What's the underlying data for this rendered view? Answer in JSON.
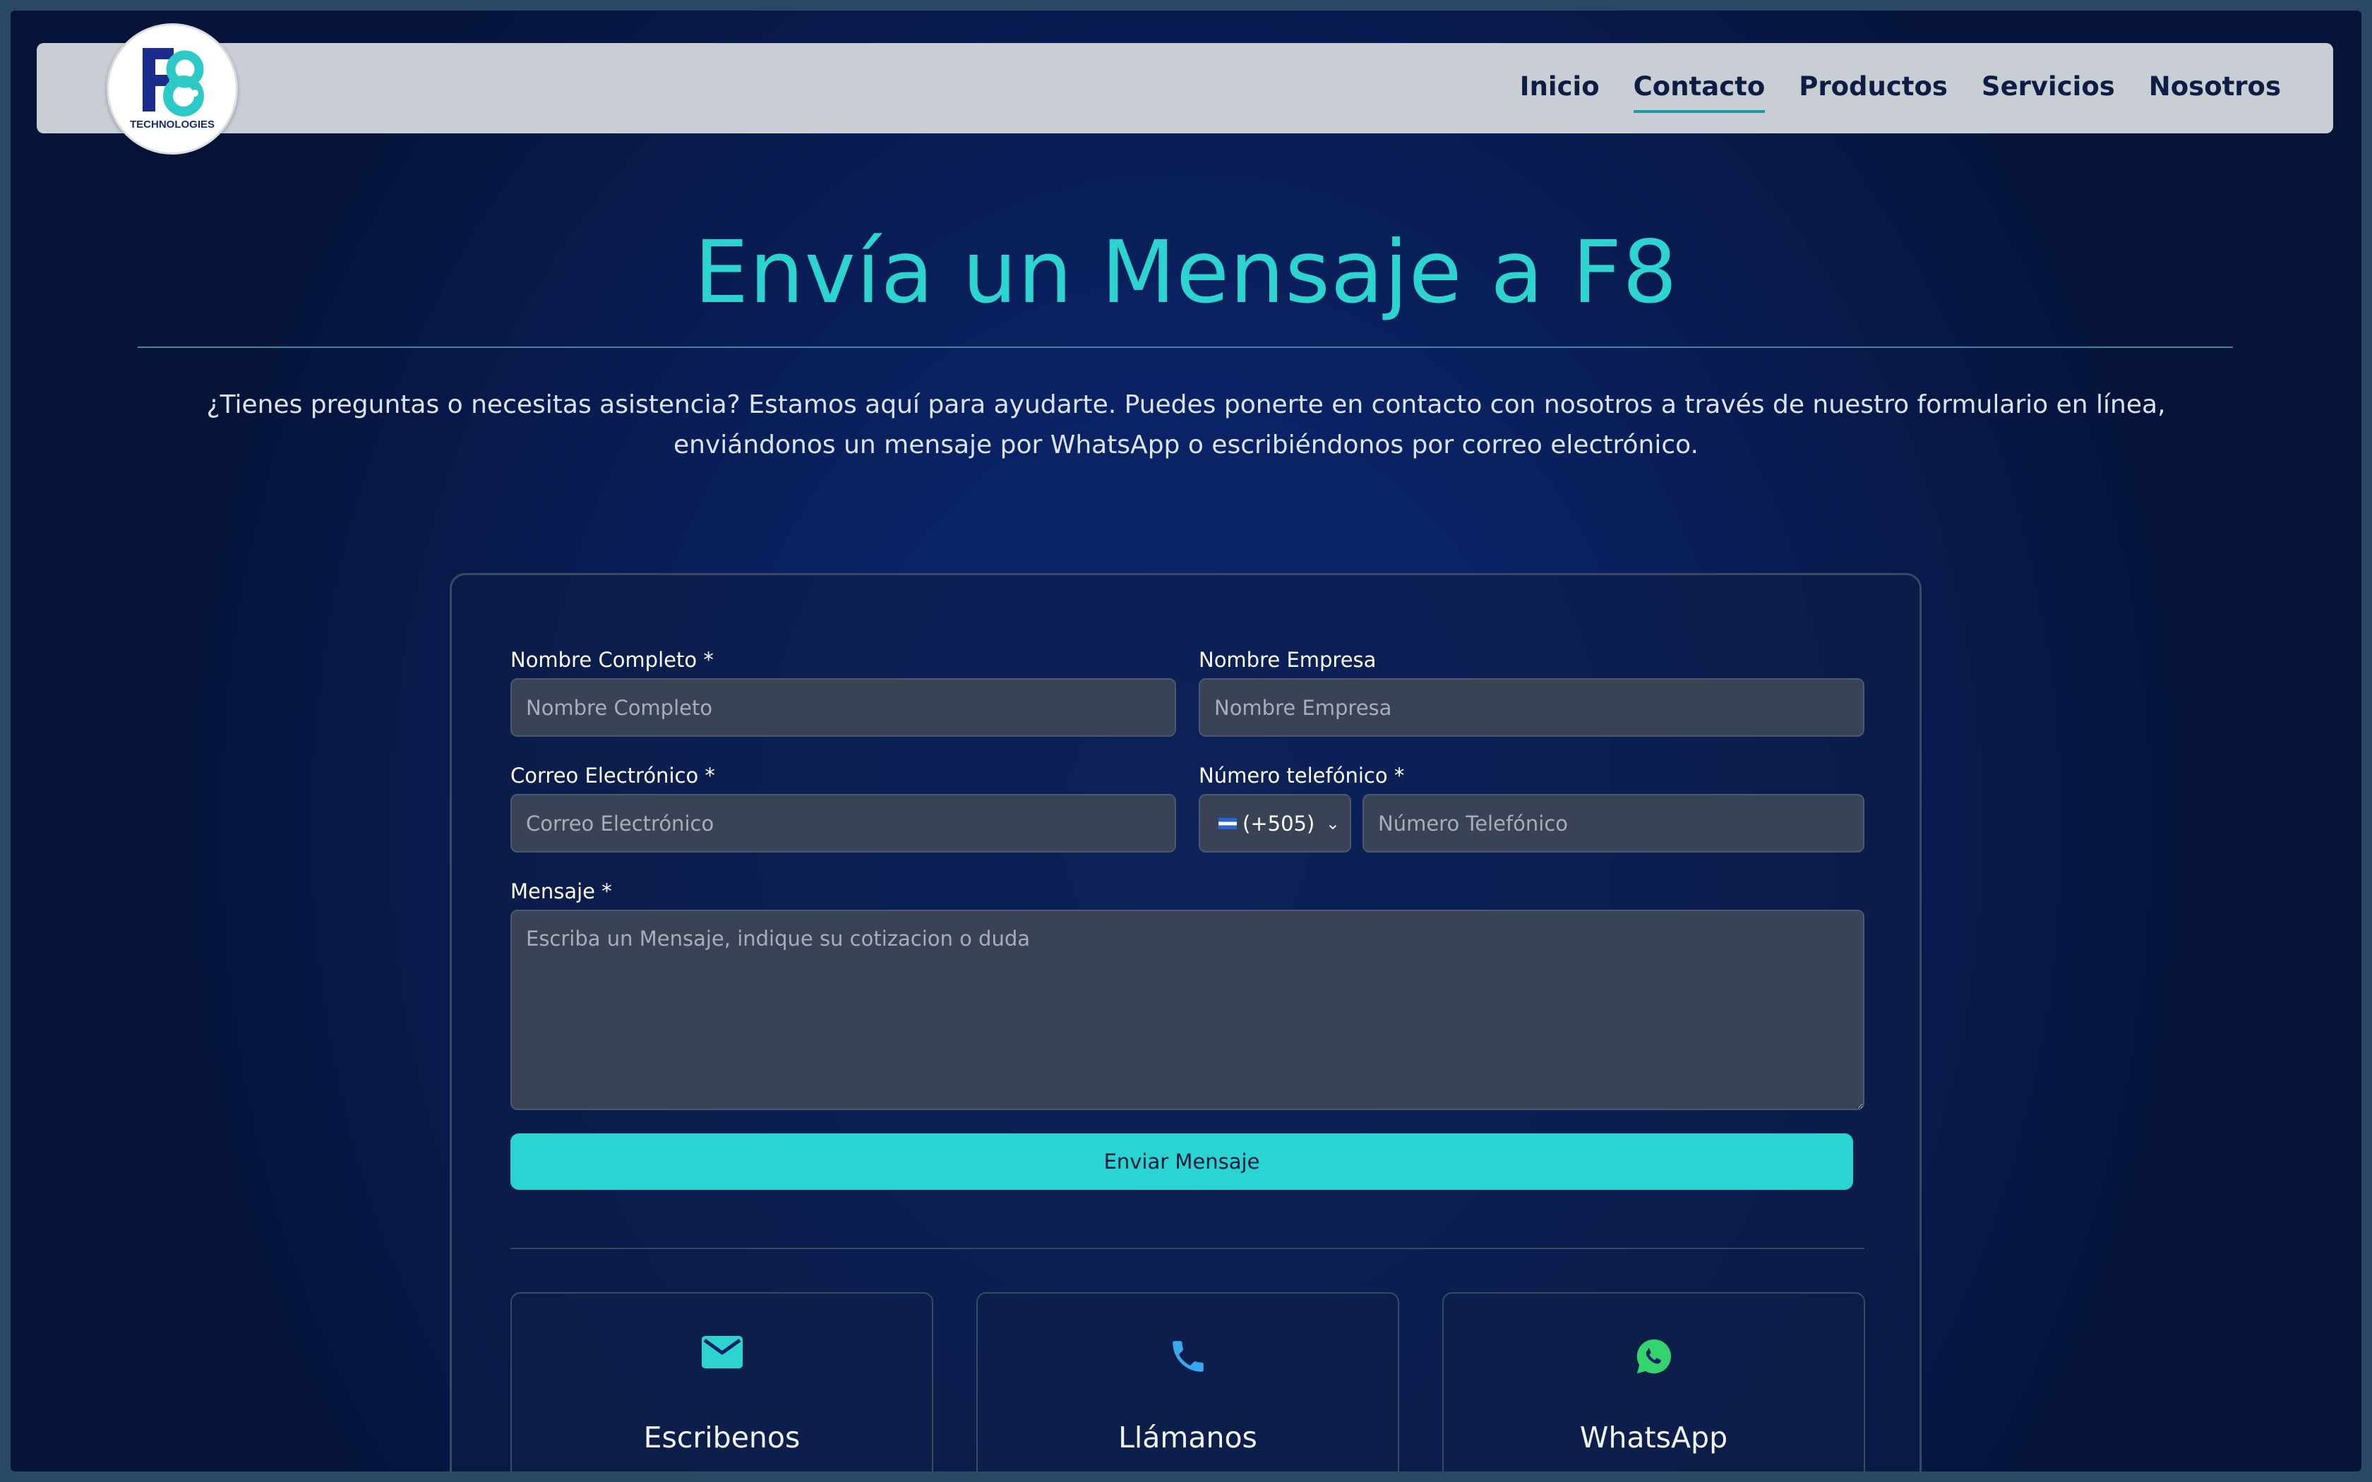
{
  "brand": {
    "logo_alt": "F8 Technologies",
    "logo_text": "TECHNOLOGIES"
  },
  "nav": {
    "items": [
      {
        "label": "Inicio"
      },
      {
        "label": "Contacto",
        "active": true
      },
      {
        "label": "Productos"
      },
      {
        "label": "Servicios"
      },
      {
        "label": "Nosotros"
      }
    ]
  },
  "hero": {
    "title": "Envía un Mensaje a F8",
    "intro": "¿Tienes preguntas o necesitas asistencia? Estamos aquí para ayudarte. Puedes ponerte en contacto con nosotros a través de nuestro formulario en línea, enviándonos un mensaje por WhatsApp o escribiéndonos por correo electrónico."
  },
  "form": {
    "full_name": {
      "label": "Nombre Completo *",
      "placeholder": "Nombre Completo",
      "value": ""
    },
    "company": {
      "label": "Nombre Empresa",
      "placeholder": "Nombre Empresa",
      "value": ""
    },
    "email": {
      "label": "Correo Electrónico *",
      "placeholder": "Correo Electrónico",
      "value": ""
    },
    "phone": {
      "label": "Número telefónico *",
      "country_code": "(+505)",
      "placeholder": "Número Telefónico",
      "value": ""
    },
    "message": {
      "label": "Mensaje *",
      "placeholder": "Escriba un Mensaje, indique su cotizacion o duda",
      "value": ""
    },
    "submit_label": "Enviar Mensaje"
  },
  "contact_options": [
    {
      "label": "Escribenos",
      "icon": "mail-icon",
      "color": "#2dd4cf"
    },
    {
      "label": "Llámanos",
      "icon": "phone-icon",
      "color": "#3aa7ee"
    },
    {
      "label": "WhatsApp",
      "icon": "whatsapp-icon",
      "color": "#35d36c"
    }
  ],
  "colors": {
    "accent": "#2dd4cf",
    "button": "#2ad4d2",
    "background": "#0a2262",
    "navbar": "#c9cdd4"
  }
}
